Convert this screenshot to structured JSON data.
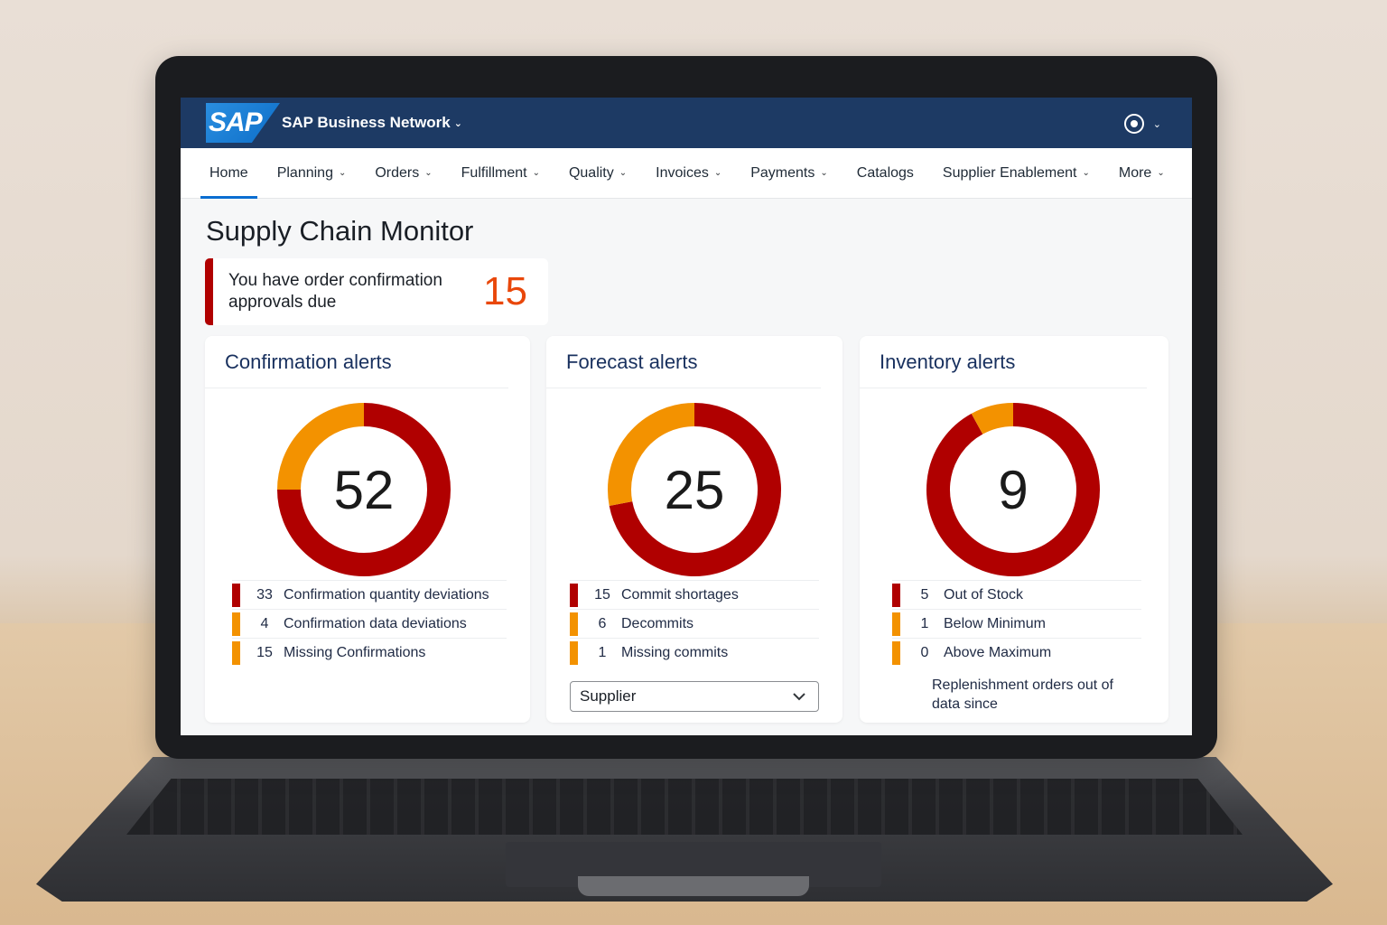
{
  "shellbar": {
    "logo": "SAP",
    "brand": "SAP Business Network",
    "brand_chevron": "⌄",
    "user_chevron": "⌄"
  },
  "tabs": [
    {
      "label": "Home",
      "chev": ""
    },
    {
      "label": "Planning",
      "chev": "⌄"
    },
    {
      "label": "Orders",
      "chev": "⌄"
    },
    {
      "label": "Fulfillment",
      "chev": "⌄"
    },
    {
      "label": "Quality",
      "chev": "⌄"
    },
    {
      "label": "Invoices",
      "chev": "⌄"
    },
    {
      "label": "Payments",
      "chev": "⌄"
    },
    {
      "label": "Catalogs",
      "chev": ""
    },
    {
      "label": "Supplier Enablement",
      "chev": "⌄"
    },
    {
      "label": "More",
      "chev": "⌄"
    }
  ],
  "page": {
    "title": "Supply Chain Monitor"
  },
  "approval": {
    "text": "You have order confirmation approvals due",
    "count": "15"
  },
  "colors": {
    "red": "#b00000",
    "orange": "#f39200",
    "accent": "#0a6ed1",
    "shell": "#1d3a64"
  },
  "cards": {
    "confirmation": {
      "title": "Confirmation alerts",
      "total": "52",
      "items": [
        {
          "value": "33",
          "label": "Confirmation quantity deviations",
          "color": "red"
        },
        {
          "value": "4",
          "label": "Confirmation data deviations",
          "color": "orange"
        },
        {
          "value": "15",
          "label": "Missing Confirmations",
          "color": "orange"
        }
      ]
    },
    "forecast": {
      "title": "Forecast alerts",
      "total": "25",
      "items": [
        {
          "value": "15",
          "label": "Commit shortages",
          "color": "red"
        },
        {
          "value": "6",
          "label": "Decommits",
          "color": "orange"
        },
        {
          "value": "1",
          "label": "Missing commits",
          "color": "orange"
        }
      ],
      "select": {
        "value": "Supplier"
      }
    },
    "inventory": {
      "title": "Inventory alerts",
      "total": "9",
      "items": [
        {
          "value": "5",
          "label": "Out of Stock",
          "color": "red"
        },
        {
          "value": "1",
          "label": "Below Minimum",
          "color": "orange"
        },
        {
          "value": "0",
          "label": "Above Maximum",
          "color": "orange"
        }
      ],
      "note": "Replenishment orders out of data since"
    }
  },
  "chart_data": [
    {
      "type": "pie",
      "categories": [
        "red",
        "orange"
      ],
      "values": [
        75,
        25
      ]
    },
    {
      "type": "pie",
      "categories": [
        "red",
        "orange"
      ],
      "values": [
        72,
        28
      ]
    },
    {
      "type": "pie",
      "categories": [
        "red",
        "orange"
      ],
      "values": [
        92,
        8
      ]
    }
  ]
}
